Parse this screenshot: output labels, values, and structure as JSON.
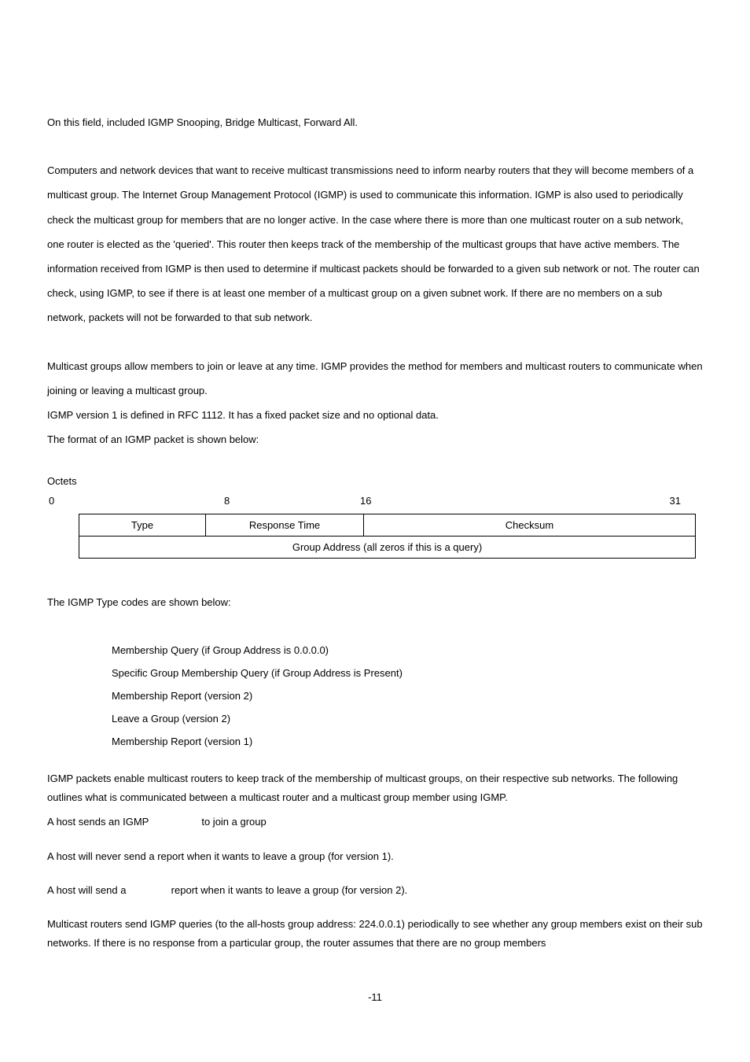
{
  "intro": {
    "line1": "On this field, included IGMP Snooping, Bridge Multicast, Forward All.",
    "para1": "Computers and network devices that want to receive multicast transmissions need to inform nearby routers that they will become members of a multicast group. The Internet Group Management Protocol (IGMP) is used to communicate this information. IGMP is also used to periodically check the multicast group for members that are no longer active. In the case where there is more than one multicast router on a sub network, one router is elected as the 'queried'. This router then keeps track of the membership of the multicast groups that have active members. The information received from IGMP is then used to determine if multicast packets should be forwarded to a given sub network or not. The router can check, using IGMP, to see if there is at least one member of a multicast group on a given subnet work. If there are no members on a sub network, packets will not be forwarded to that sub network.",
    "para2a": "Multicast groups allow members to join or leave at any time. IGMP provides the method for members and multicast routers to communicate when joining or leaving a multicast group.",
    "para2b": "IGMP version 1 is defined in RFC 1112. It has a fixed packet size and no optional data.",
    "para2c": "The format of an IGMP packet is shown below:"
  },
  "packet": {
    "octets_label": "Octets",
    "bits": {
      "b0": "0",
      "b8": "8",
      "b16": "16",
      "b31": "31"
    },
    "row1": {
      "type": "Type",
      "response_time": "Response Time",
      "checksum": "Checksum"
    },
    "row2": "Group Address (all zeros if this is a query)"
  },
  "type_codes": {
    "intro": "The IGMP Type codes are shown below:",
    "codes": [
      {
        "desc": "Membership Query (if Group Address is 0.0.0.0)"
      },
      {
        "desc": "Specific Group Membership Query (if Group Address is Present)"
      },
      {
        "desc": "Membership Report (version 2)"
      },
      {
        "desc": "Leave a Group (version 2)"
      },
      {
        "desc": "Membership Report (version 1)"
      }
    ]
  },
  "trailing": {
    "p1": "IGMP packets enable multicast routers to keep track of the membership of multicast groups, on their respective sub networks. The following outlines what is communicated between a multicast router and a multicast group member using IGMP.",
    "p2a": "A host sends an IGMP ",
    "p2b": " to join a group",
    "p3": "A host will never send a report when it wants to leave a group (for version 1).",
    "p4a": "A host will send a ",
    "p4b": " report when it wants to leave a group (for version 2).",
    "p5": "Multicast routers send IGMP queries (to the all-hosts group address: 224.0.0.1) periodically to see whether any group members exist on their sub networks. If there is no response from a particular group, the router assumes that there are no group members"
  },
  "page_number": "-11"
}
